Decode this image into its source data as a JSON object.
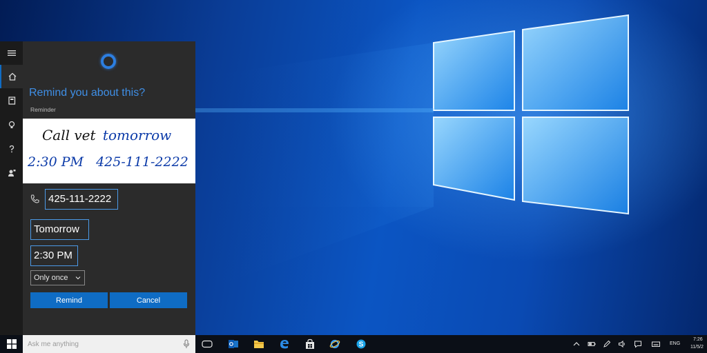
{
  "cortana": {
    "question": "Remind you about this?",
    "section_label": "Reminder",
    "ink_line1_dark": "Call vet",
    "ink_line1_blue": "tomorrow",
    "ink_line2": "2:30 PM   425-111-2222",
    "phone": "425-111-2222",
    "date": "Tomorrow",
    "time": "2:30 PM",
    "repeat": "Only once",
    "remind_label": "Remind",
    "cancel_label": "Cancel"
  },
  "rail": {
    "icons": [
      "hamburger-menu-icon",
      "home-icon",
      "notebook-icon",
      "lightbulb-icon",
      "help-icon",
      "feedback-icon"
    ]
  },
  "taskbar": {
    "search_placeholder": "Ask me anything",
    "language": "ENG",
    "time": "7:26",
    "date": "11/5/2"
  },
  "colors": {
    "accent": "#0f6cc4",
    "title_blue": "#3f8fe6",
    "panel_bg": "#2b2b2b",
    "rail_bg": "#1b1b1b",
    "ink_blue": "#0b3aa8",
    "taskbar_bg": "#0b0f17"
  }
}
